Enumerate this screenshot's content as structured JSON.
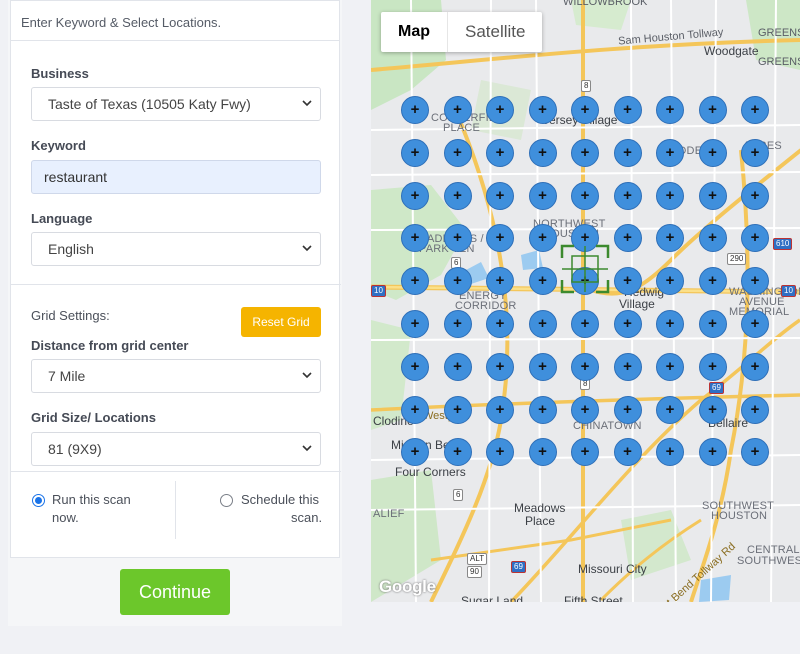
{
  "form": {
    "header": "Enter Keyword & Select Locations.",
    "business_label": "Business",
    "business_value": "Taste of Texas (10505 Katy Fwy)",
    "keyword_label": "Keyword",
    "keyword_value": "restaurant",
    "language_label": "Language",
    "language_value": "English",
    "grid_settings_label": "Grid Settings:",
    "reset_grid_label": "Reset Grid",
    "distance_label": "Distance from grid center",
    "distance_value": "7 Mile",
    "grid_size_label": "Grid Size/ Locations",
    "grid_size_value": "81 (9X9)",
    "run_now_label_1": "Run this scan",
    "run_now_label_2": "now.",
    "schedule_label_1": "Schedule this",
    "schedule_label_2": "scan.",
    "run_now_checked": true,
    "continue_label": "Continue"
  },
  "map": {
    "toggle_map": "Map",
    "toggle_satellite": "Satellite",
    "active_view": "Map",
    "grid_rows": 9,
    "grid_cols": 9,
    "marker_glyph": "+",
    "marker_color": "#3f8fdc",
    "center_marker_color": "#3c8a2e",
    "labels": {
      "willowbrook": "WILLOWBROOK",
      "sam_houston": "Sam Houston Tollway",
      "woodgate": "Woodgate",
      "greens": "GREENS",
      "greenspoint": "GREENSPOINT",
      "copperfield_1": "COPPERFIELD",
      "copperfield_2": "PLACE",
      "jersey_village": "Jersey Village",
      "hidden": "HIDDEN",
      "acres": "ACRES",
      "northwest_1": "NORTHWEST",
      "northwest_2": "HOUSTON",
      "addicks_1": "ADDICKS /",
      "addicks_2": "PARK TEN",
      "energy_1": "ENERGY",
      "energy_2": "CORRIDOR",
      "hedwig_1": "Hedwig",
      "hedwig_2": "Village",
      "washington": "WASHINGTON",
      "avenue": "AVENUE",
      "memorial": "MEMORIAL",
      "westpark": "Westpark",
      "cinco": "Mission Bend",
      "chinatown": "CHINATOWN",
      "bellaire": "Bellaire",
      "cloine": "Clodine",
      "four_corners": "Four Corners",
      "alief": "ALIEF",
      "meadows_1": "Meadows",
      "meadows_2": "Place",
      "southwest_1": "SOUTHWEST",
      "southwest_2": "HOUSTON",
      "central_1": "CENTRAL",
      "central_2": "SOUTHWEST",
      "missouri_city": "Missouri City",
      "fifth_street": "Fifth Street",
      "sugar_land": "Sugar Land",
      "tollway": "Fort Bend Tollway Rd",
      "google": "Google"
    },
    "shields": {
      "hw8_top": "8",
      "hw8_mid": "8",
      "hw6_top": "6",
      "hw6_bot": "6",
      "i610_top": "610",
      "i610_bot": "610",
      "us290": "290",
      "i10_left": "10",
      "i10_right": "10",
      "i69": "69",
      "i69_bot": "69",
      "us90": "90",
      "alt": "ALT"
    }
  }
}
